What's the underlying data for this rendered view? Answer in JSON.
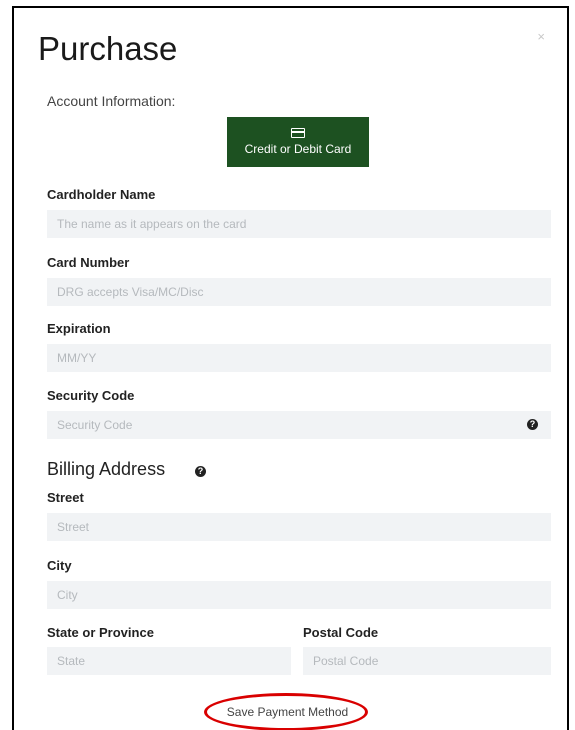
{
  "modal": {
    "title": "Purchase",
    "close_glyph": "×",
    "subtitle": "Account Information:",
    "payment_button_label": "Credit or Debit Card"
  },
  "fields": {
    "cardholder": {
      "label": "Cardholder Name",
      "placeholder": "The name as it appears on the card",
      "value": ""
    },
    "card_number": {
      "label": "Card Number",
      "placeholder": "DRG accepts Visa/MC/Disc",
      "value": ""
    },
    "expiration": {
      "label": "Expiration",
      "placeholder": "MM/YY",
      "value": ""
    },
    "security_code": {
      "label": "Security Code",
      "placeholder": "Security Code",
      "value": ""
    },
    "street": {
      "label": "Street",
      "placeholder": "Street",
      "value": ""
    },
    "city": {
      "label": "City",
      "placeholder": "City",
      "value": ""
    },
    "state": {
      "label": "State or Province",
      "placeholder": "State",
      "value": ""
    },
    "postal_code": {
      "label": "Postal Code",
      "placeholder": "Postal Code",
      "value": ""
    }
  },
  "billing": {
    "title": "Billing Address"
  },
  "help_glyph": "?",
  "save_link": "Save Payment Method",
  "icons": {
    "card": "credit-card-icon",
    "help": "question-circle-icon",
    "close": "close-icon"
  },
  "colors": {
    "primary_button": "#1d5121",
    "field_background": "#f1f3f5",
    "annotation": "#d90000"
  }
}
